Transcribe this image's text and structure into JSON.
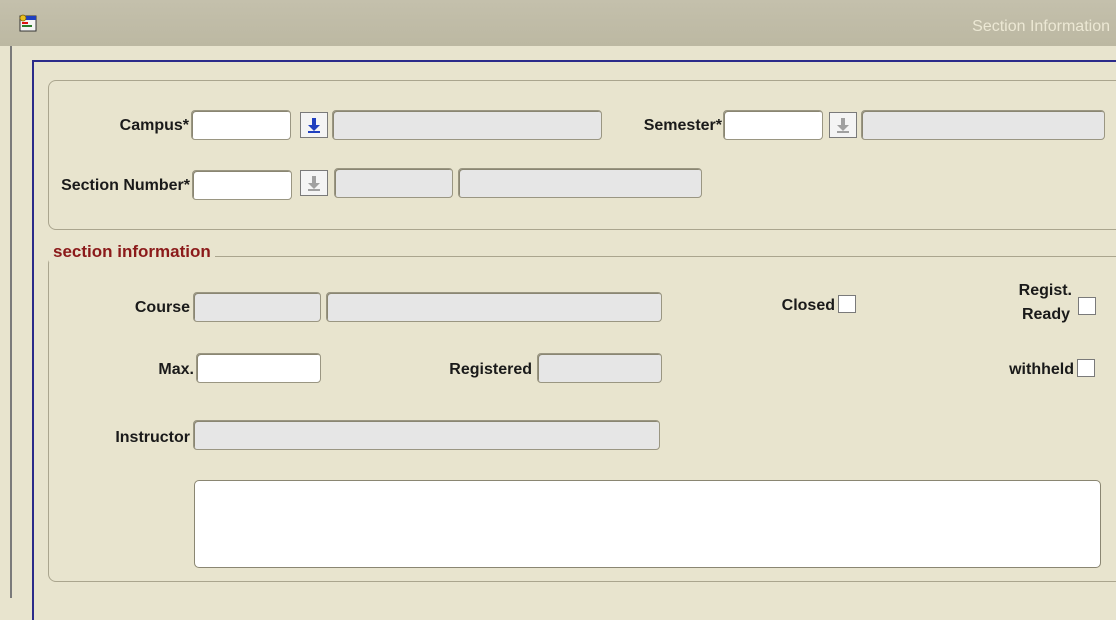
{
  "window": {
    "title": "Section Information",
    "icon": "app-window-icon"
  },
  "key_block": {
    "campus": {
      "label": "Campus*",
      "value": "",
      "description": "",
      "lov_icon": "down-arrow-icon"
    },
    "semester": {
      "label": "Semester*",
      "value": "",
      "description": "",
      "lov_icon": "down-arrow-icon"
    },
    "section_number": {
      "label": "Section Number*",
      "value": "",
      "detail_1": "",
      "detail_2": "",
      "lov_icon": "down-arrow-icon"
    }
  },
  "section_info": {
    "legend": "section information",
    "course": {
      "label": "Course",
      "code": "",
      "title": ""
    },
    "max": {
      "label": "Max.",
      "value": ""
    },
    "registered": {
      "label": "Registered",
      "value": ""
    },
    "instructor": {
      "label": "Instructor",
      "value": ""
    },
    "closed": {
      "label": "Closed",
      "checked": false
    },
    "regist_ready": {
      "label_line1": "Regist.",
      "label_line2": "Ready",
      "checked": false
    },
    "withheld": {
      "label": "withheld",
      "checked": false
    },
    "notes": {
      "value": ""
    }
  },
  "colors": {
    "background": "#e8e4ce",
    "titlebar": "#c0bca6",
    "legend_text": "#8b1a1a",
    "frame_border": "#2b2b8a",
    "lov_arrow_active": "#1f3fbf",
    "lov_arrow_disabled": "#a0a0a0"
  }
}
